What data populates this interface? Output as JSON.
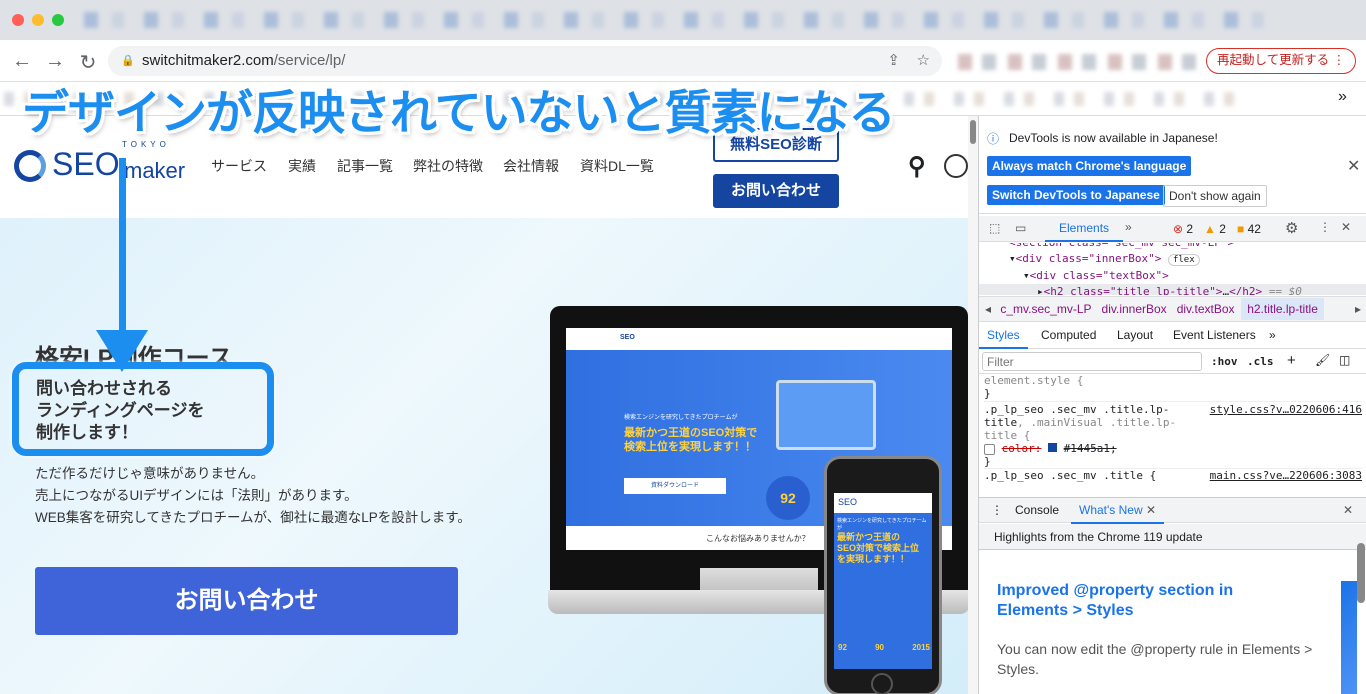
{
  "browser": {
    "url_host": "switchitmaker2.com",
    "url_path": "/service/lp/",
    "restart_label": "再起動して更新する",
    "more_label": "⋮",
    "bookmarks_more": "»"
  },
  "overlay": {
    "caption": "デザインが反映されていないと質素になる",
    "accent": "#1c8ef0"
  },
  "site": {
    "logo_main": "SEO",
    "logo_sub": "maker",
    "logo_tokyo": "TOKYO",
    "nav": [
      "サービス",
      "実績",
      "記事一覧",
      "弊社の特徴",
      "会社情報",
      "資料DL一覧"
    ],
    "free_diag": "無料SEO診断",
    "contact": "お問い合わせ",
    "brand_color": "#1445a1"
  },
  "hero": {
    "title": "格安LP制作コース",
    "subtitle_lines": [
      "問い合わせされる",
      "ランディングページを",
      "制作します！"
    ],
    "body_lines": [
      "ただ作るだけじゃ意味がありません。",
      "売上につながるUIデザインには「法則」があります。",
      "WEB集客を研究してきたプロチームが、御社に最適なLPを設計します。"
    ],
    "cta": "お問い合わせ",
    "cta_color": "#3f63d8"
  },
  "mockup": {
    "lead": "検索エンジンを研究してきたプロチームが",
    "headline_1": "最新かつ王道のSEO対策で",
    "headline_2": "検索上位を実現します！！",
    "download": "資料ダウンロード",
    "stat": "92",
    "section": "こんなお悩みありませんか？",
    "phone_lead": "検索エンジンを研究してきたプロチームが",
    "phone_headline_1": "最新かつ王道の",
    "phone_headline_2": "SEO対策で検索上位",
    "phone_headline_3": "を実現します！！",
    "phone_stats": [
      "92",
      "90",
      "2015"
    ]
  },
  "devtools": {
    "banner": "DevTools is now available in Japanese!",
    "btn_match": "Always match Chrome's language",
    "btn_switch": "Switch DevTools to Japanese",
    "btn_dont": "Don't show again",
    "tab_elements": "Elements",
    "errors": "2",
    "warnings": "2",
    "issues": "42",
    "dom": {
      "line0": "<section class=\"sec_mv sec_mv-LP\">",
      "line1_tag": "<div class=\"innerBox\">",
      "line1_badge": "flex",
      "line2_tag": "<div class=\"textBox\">",
      "line3_tag": "<h2 class=\"title lp-title\">",
      "line3_end": "</h2>",
      "line3_eq": "== $0"
    },
    "breadcrumbs": [
      "c_mv.sec_mv-LP",
      "div.innerBox",
      "div.textBox",
      "h2.title.lp-title"
    ],
    "style_tabs": [
      "Styles",
      "Computed",
      "Layout",
      "Event Listeners"
    ],
    "filter_placeholder": "Filter",
    "hov": ":hov",
    "cls": ".cls",
    "rules": {
      "element_style": "element.style {",
      "close": "}",
      "sel1a": ".p_lp_seo .sec_mv .title.lp-",
      "sel1b": "title",
      "sel1c": ", .mainVisual .title.lp-",
      "sel1d": "title {",
      "src1": "style.css?v…0220606:416",
      "prop": "color:",
      "propval": "#1445a1;",
      "sel2": ".p_lp_seo .sec_mv .title {",
      "src2": "main.css?ve…220606:3083"
    },
    "drawer_tabs": [
      "Console",
      "What's New"
    ],
    "highlights": "Highlights from the Chrome 119 update",
    "news_title": "Improved @property section in Elements > Styles",
    "news_body": "You can now edit the @property rule in Elements > Styles."
  }
}
